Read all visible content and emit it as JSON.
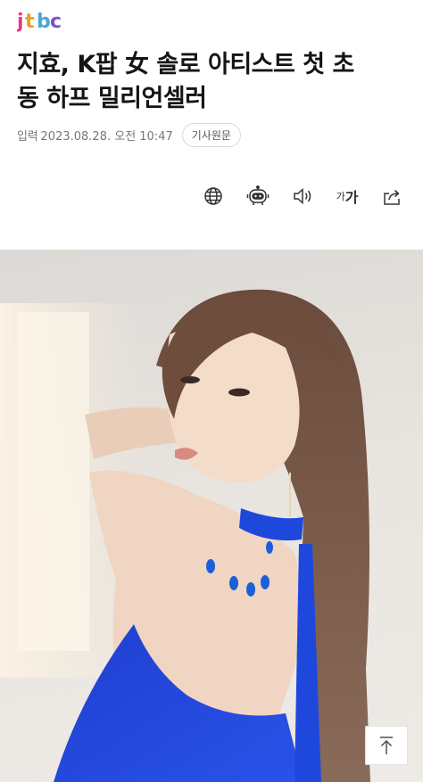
{
  "brand": {
    "name": "jtbc",
    "colors": [
      "#e83a7c",
      "#f39c1f",
      "#4aa6d8",
      "#7c4fd1"
    ]
  },
  "article": {
    "headline_line1": "지효, K팝 女 솔로 아티스트 첫 초",
    "headline_line2": "동 하프 밀리언셀러",
    "meta_label": "입력",
    "date": "2023.08.28. 오전 10:47",
    "original_button": "기사원문"
  },
  "toolbar": {
    "items": [
      {
        "icon": "globe-icon"
      },
      {
        "icon": "robot-summary-icon"
      },
      {
        "icon": "speaker-icon"
      },
      {
        "icon": "font-size-icon",
        "small": "가",
        "large": "가"
      },
      {
        "icon": "share-icon"
      }
    ]
  },
  "photo": {
    "subject": "woman in blue dress with blue nails"
  },
  "scroll_top": {
    "icon": "arrow-up-icon"
  }
}
